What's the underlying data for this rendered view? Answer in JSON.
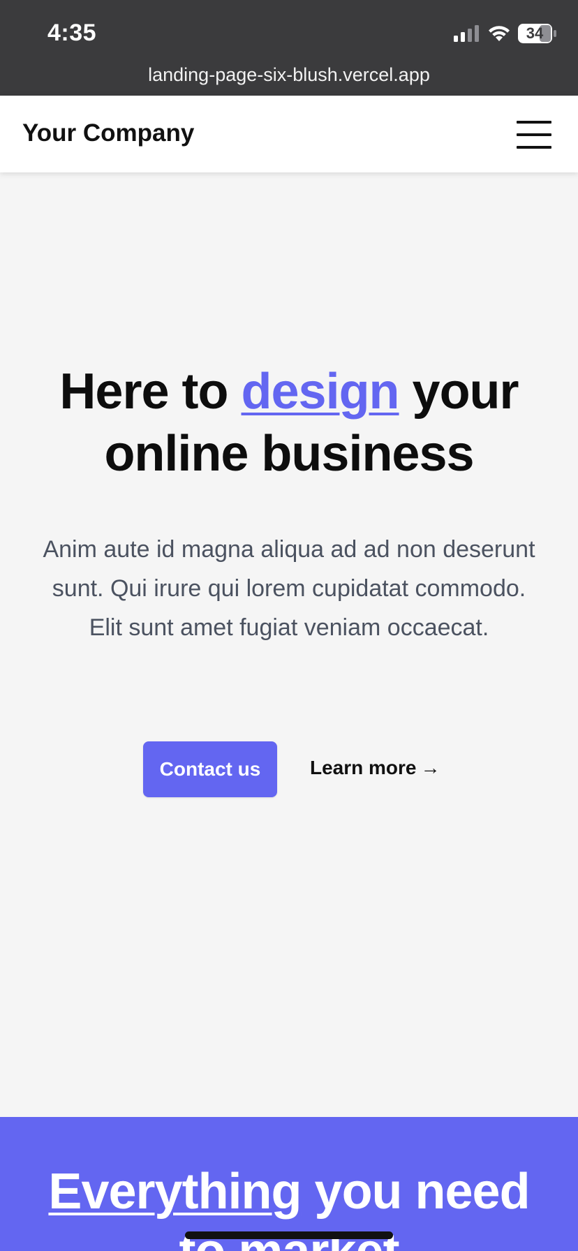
{
  "status_bar": {
    "time": "4:35",
    "battery": "34"
  },
  "browser": {
    "url": "landing-page-six-blush.vercel.app"
  },
  "header": {
    "brand": "Your Company",
    "menu_icon": "hamburger-menu-icon"
  },
  "hero": {
    "title_before": "Here to ",
    "title_highlight": "design",
    "title_after": " your online business",
    "body": "Anim aute id magna aliqua ad ad non deserunt sunt. Qui irure qui lorem cupidatat commodo. Elit sunt amet fugiat veniam occaecat.",
    "primary_button": "Contact us",
    "secondary_link": "Learn more",
    "secondary_arrow": "→"
  },
  "features": {
    "title_underlined": "Everything",
    "title_rest": " you need to market"
  },
  "colors": {
    "accent": "#6366f1",
    "chrome": "#3b3b3d",
    "page_background": "#f5f5f5",
    "body_text": "#4b5260"
  }
}
